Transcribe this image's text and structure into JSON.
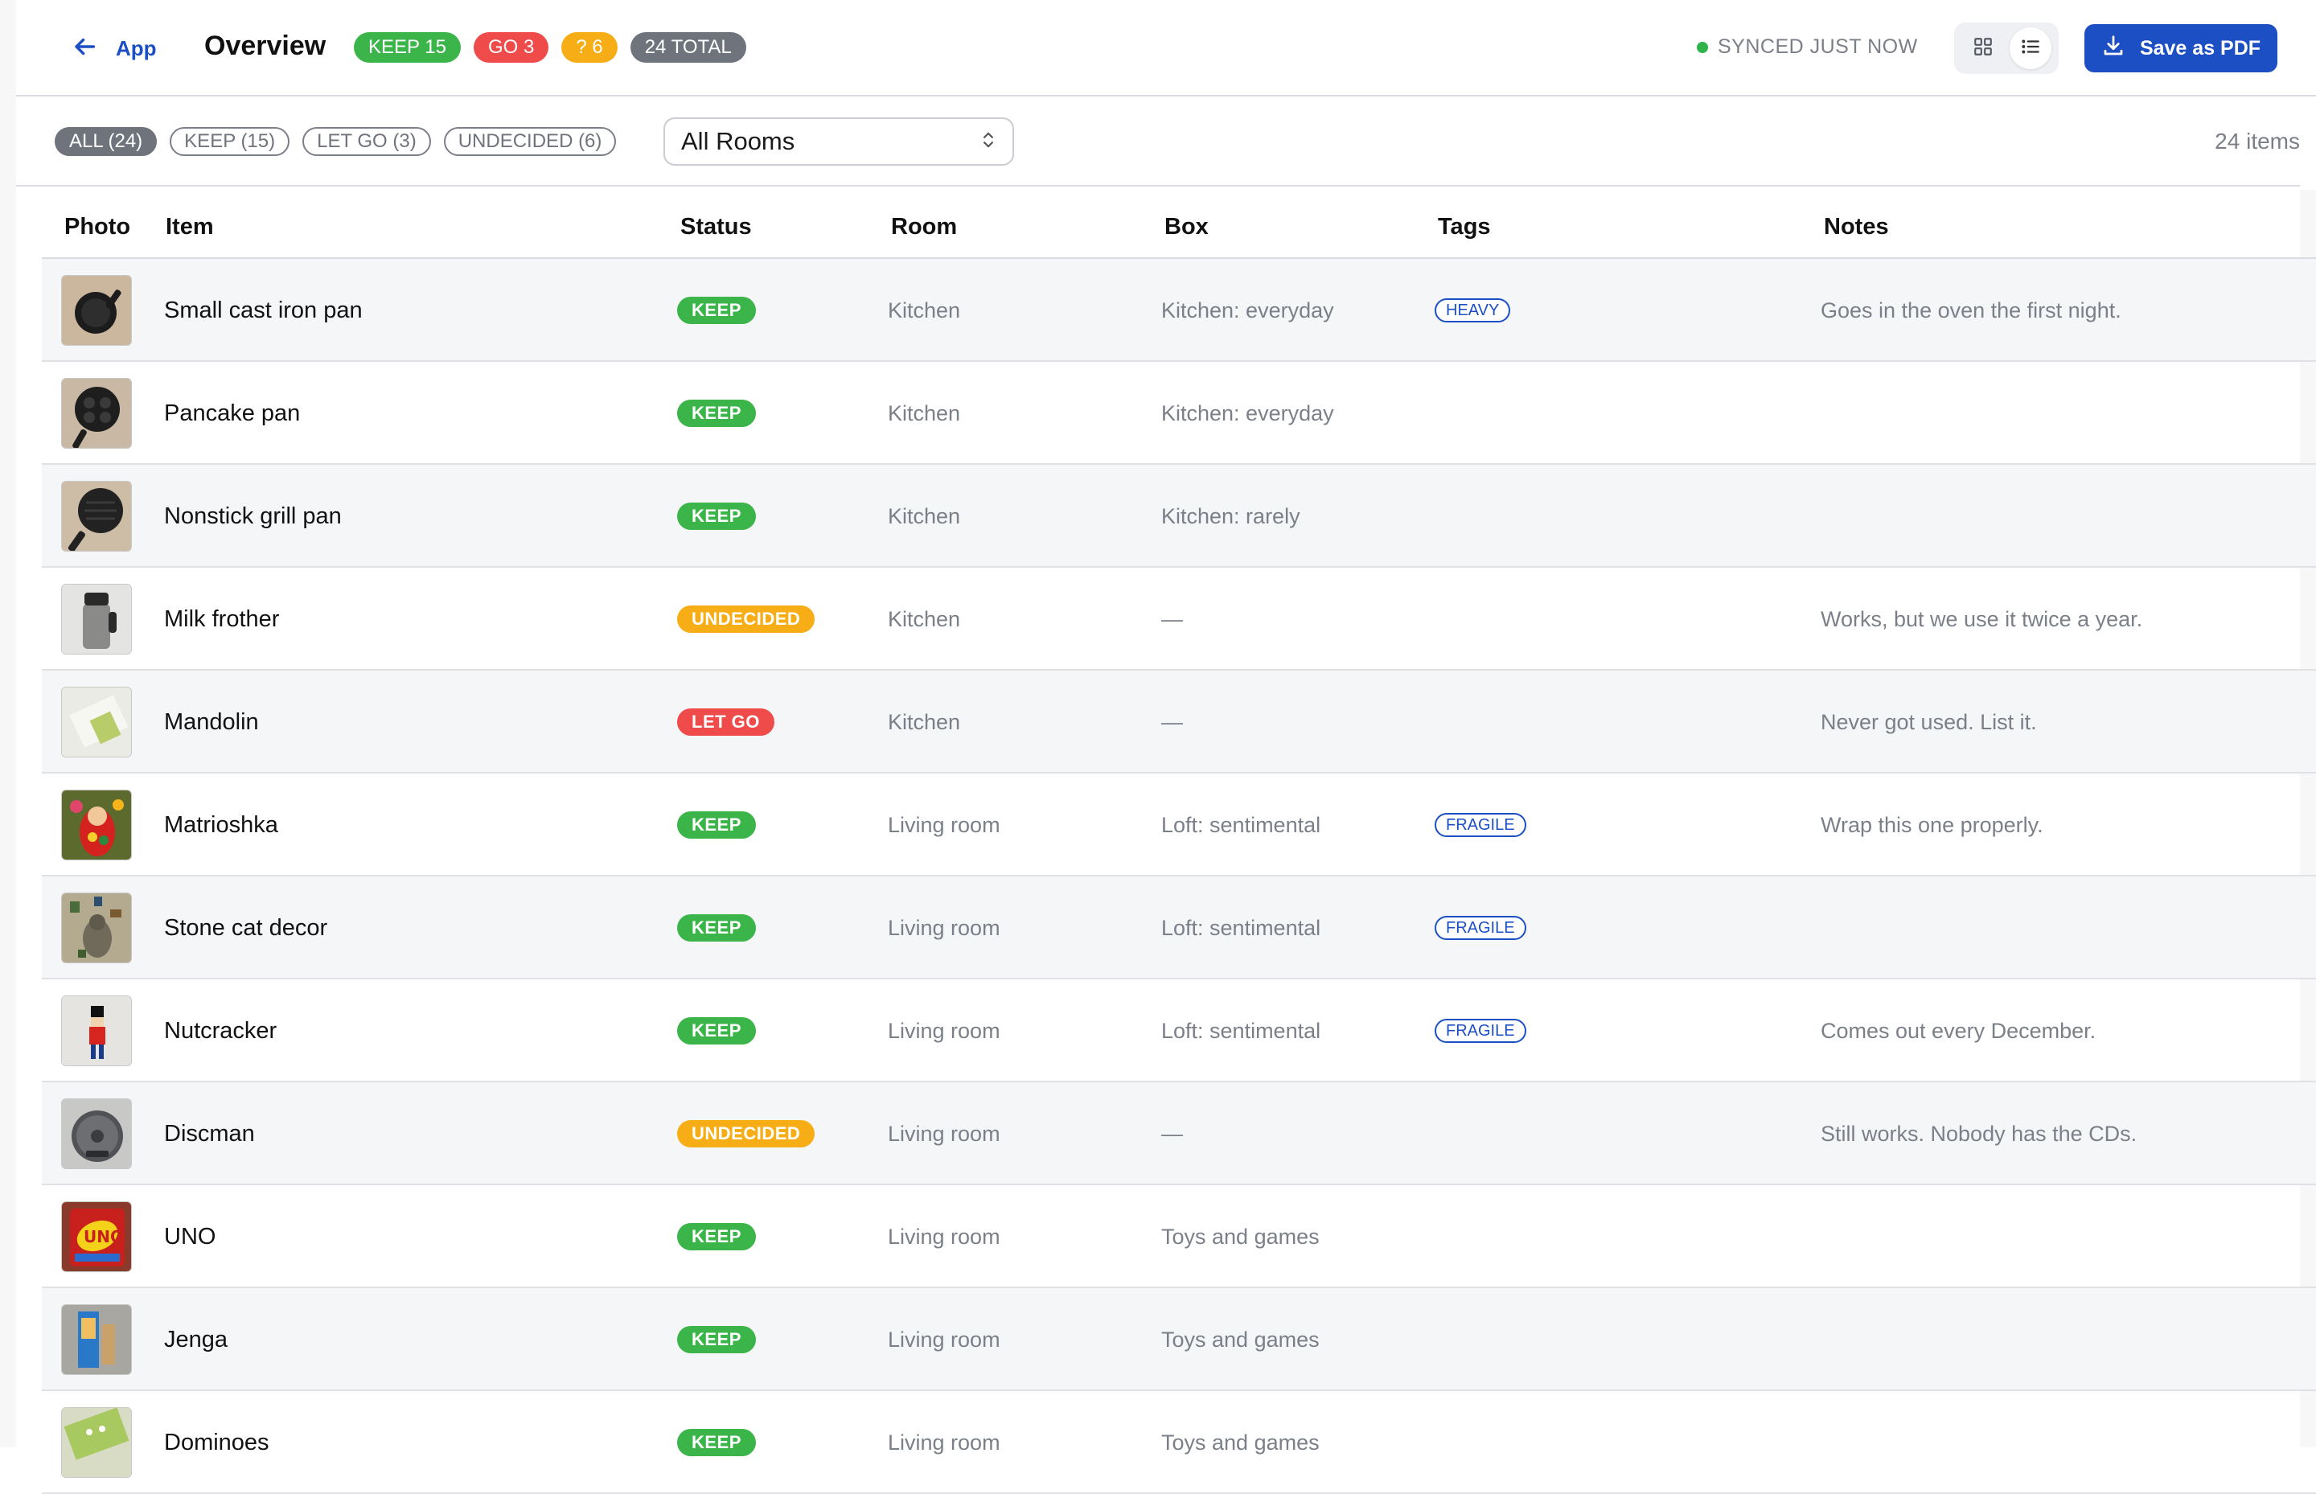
{
  "colors": {
    "keep": "#3bb54a",
    "go": "#ef4b4b",
    "undecided": "#f7ad15",
    "total": "#6f737b",
    "accent": "#1d4fc4",
    "synced": "#2fb34a"
  },
  "header": {
    "back_label": "App",
    "title": "Overview",
    "summary": [
      {
        "label": "KEEP 15",
        "color": "#3bb54a"
      },
      {
        "label": "GO 3",
        "color": "#ef4b4b"
      },
      {
        "label": "? 6",
        "color": "#f7ad15"
      },
      {
        "label": "24 TOTAL",
        "color": "#6f737b"
      }
    ],
    "sync_status": "SYNCED JUST NOW",
    "view_modes": [
      "grid-icon",
      "list-icon"
    ],
    "active_view": "list",
    "save_pdf_label": "Save as PDF"
  },
  "filters": {
    "chips": [
      {
        "label": "ALL (24)",
        "active": true
      },
      {
        "label": "KEEP (15)",
        "active": false
      },
      {
        "label": "LET GO (3)",
        "active": false
      },
      {
        "label": "UNDECIDED (6)",
        "active": false
      }
    ],
    "room_select": "All Rooms",
    "item_count": "24 items"
  },
  "table": {
    "columns": [
      "Photo",
      "Item",
      "Status",
      "Room",
      "Box",
      "Tags",
      "Notes"
    ],
    "rows": [
      {
        "item": "Small cast iron pan",
        "status": "KEEP",
        "room": "Kitchen",
        "box": "Kitchen: everyday",
        "tag": "HEAVY",
        "notes": "Goes in the oven the first night.",
        "photo": "pan-photo"
      },
      {
        "item": "Pancake pan",
        "status": "KEEP",
        "room": "Kitchen",
        "box": "Kitchen: everyday",
        "tag": "",
        "notes": "",
        "photo": "pancake-pan-photo"
      },
      {
        "item": "Nonstick grill pan",
        "status": "KEEP",
        "room": "Kitchen",
        "box": "Kitchen: rarely",
        "tag": "",
        "notes": "",
        "photo": "grill-pan-photo"
      },
      {
        "item": "Milk frother",
        "status": "UNDECIDED",
        "room": "Kitchen",
        "box": "—",
        "tag": "",
        "notes": "Works, but we use it twice a year.",
        "photo": "frother-photo"
      },
      {
        "item": "Mandolin",
        "status": "LET GO",
        "room": "Kitchen",
        "box": "—",
        "tag": "",
        "notes": "Never got used. List it.",
        "photo": "mandolin-photo"
      },
      {
        "item": "Matrioshka",
        "status": "KEEP",
        "room": "Living room",
        "box": "Loft: sentimental",
        "tag": "FRAGILE",
        "notes": "Wrap this one properly.",
        "photo": "matrioshka-photo"
      },
      {
        "item": "Stone cat decor",
        "status": "KEEP",
        "room": "Living room",
        "box": "Loft: sentimental",
        "tag": "FRAGILE",
        "notes": "",
        "photo": "stone-cat-photo"
      },
      {
        "item": "Nutcracker",
        "status": "KEEP",
        "room": "Living room",
        "box": "Loft: sentimental",
        "tag": "FRAGILE",
        "notes": "Comes out every December.",
        "photo": "nutcracker-photo"
      },
      {
        "item": "Discman",
        "status": "UNDECIDED",
        "room": "Living room",
        "box": "—",
        "tag": "",
        "notes": "Still works. Nobody has the CDs.",
        "photo": "discman-photo"
      },
      {
        "item": "UNO",
        "status": "KEEP",
        "room": "Living room",
        "box": "Toys and games",
        "tag": "",
        "notes": "",
        "photo": "uno-photo"
      },
      {
        "item": "Jenga",
        "status": "KEEP",
        "room": "Living room",
        "box": "Toys and games",
        "tag": "",
        "notes": "",
        "photo": "jenga-photo"
      },
      {
        "item": "Dominoes",
        "status": "KEEP",
        "room": "Living room",
        "box": "Toys and games",
        "tag": "",
        "notes": "",
        "photo": "dominoes-photo"
      }
    ]
  }
}
